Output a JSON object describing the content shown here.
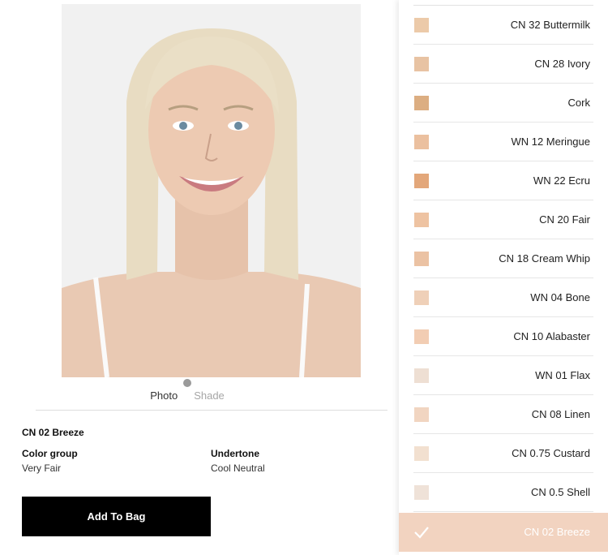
{
  "colors": {
    "selected_bg": "#f2d3c0",
    "button_bg": "#000000",
    "button_text": "#ffffff"
  },
  "gallery": {
    "tabs": [
      {
        "label": "Photo",
        "active": true
      },
      {
        "label": "Shade",
        "active": false
      }
    ]
  },
  "selected_shade": {
    "name": "CN 02 Breeze",
    "color_group_label": "Color group",
    "color_group_value": "Very Fair",
    "undertone_label": "Undertone",
    "undertone_value": "Cool Neutral"
  },
  "add_to_bag_label": "Add To Bag",
  "shades": [
    {
      "name": "CN 32 Buttermilk",
      "color": "#eccaa9"
    },
    {
      "name": "CN 28 Ivory",
      "color": "#e8c3a3"
    },
    {
      "name": "Cork",
      "color": "#dcae82"
    },
    {
      "name": "WN 12 Meringue",
      "color": "#ebc09f"
    },
    {
      "name": "WN 22 Ecru",
      "color": "#e3a77a"
    },
    {
      "name": "CN 20 Fair",
      "color": "#eec3a2"
    },
    {
      "name": "CN 18 Cream Whip",
      "color": "#ebc2a3"
    },
    {
      "name": "WN 04 Bone",
      "color": "#efd0b8"
    },
    {
      "name": "CN 10 Alabaster",
      "color": "#f2cdb3"
    },
    {
      "name": "WN 01 Flax",
      "color": "#eedfd3"
    },
    {
      "name": "CN 08 Linen",
      "color": "#f1d5c1"
    },
    {
      "name": "CN 0.75 Custard",
      "color": "#f2e0d0"
    },
    {
      "name": "CN 0.5 Shell",
      "color": "#efe2d8"
    },
    {
      "name": "CN 02 Breeze",
      "color": "#f2d3c0",
      "selected": true
    }
  ]
}
